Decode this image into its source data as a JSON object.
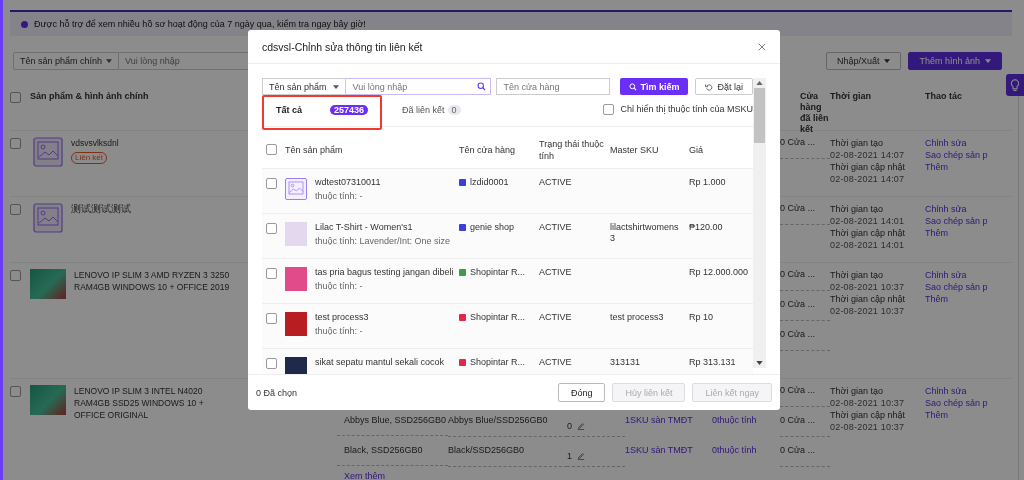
{
  "notice": {
    "text": "Được hỗ trợ để xem nhiều hồ sơ hoạt động của 7 ngày qua, kiểm tra ngay bây giờ!"
  },
  "filters": {
    "field": "Tên sản phẩm chính",
    "search": {
      "placeholder": "Vui lòng nhập"
    }
  },
  "toolbar_buttons": [
    {
      "label": "Nhập/Xuất",
      "kind": "secondary"
    },
    {
      "label": "Thêm hình ảnh",
      "kind": "primary"
    }
  ],
  "table": {
    "select_all": {
      "checked": false
    },
    "columns": [
      "Sản phẩm & hình ảnh chính",
      "Cửa hàng đã liên kết",
      "Thời gian",
      "Thao tác"
    ],
    "rows": [
      {
        "checked": false,
        "kind": "placeholder",
        "name": "vdsvsvlksdnl",
        "tag": "Liên kết",
        "variants": [
          {
            "stores": "0 Cửa ..."
          }
        ],
        "created_label": "Thời gian tạo",
        "created": "02-08-2021 14:07",
        "updated_label": "Thời gian cập nhật",
        "updated": "02-08-2021 14:07",
        "actions": [
          "Chỉnh sửa",
          "Sao chép sản p",
          "Thêm"
        ]
      },
      {
        "checked": false,
        "kind": "placeholder",
        "name": "测试测试测试",
        "variants": [
          {
            "stores": "0 Cửa ..."
          }
        ],
        "created_label": "Thời gian tạo",
        "created": "02-08-2021 14:01",
        "updated_label": "Thời gian cập nhật",
        "updated": "02-08-2021 14:01",
        "actions": [
          "Chỉnh sửa",
          "Sao chép sản p",
          "Thêm"
        ]
      },
      {
        "checked": false,
        "kind": "photo",
        "name": "LENOVO IP SLIM 3 AMD RYZEN 3 3250 RAM4GB WINDOWS 10 + OFFICE 2019",
        "variants": [
          {
            "stores": "0 Cửa ..."
          },
          {
            "stores": "0 Cửa ..."
          },
          {
            "stores": "0 Cửa ..."
          }
        ],
        "created_label": "Thời gian tạo",
        "created": "02-08-2021 10:37",
        "updated_label": "Thời gian cập nhật",
        "updated": "02-08-2021 10:37",
        "actions": [
          "Chỉnh sửa",
          "Sao chép sản p",
          "Thêm"
        ]
      },
      {
        "checked": false,
        "kind": "photo",
        "name": "LENOVO IP SLIM 3 INTEL N4020 RAM4GB SSD25 WINDOWS 10 + OFFICE ORIGINAL",
        "variants": [
          {
            "stores": "0 Cửa ..."
          },
          {
            "variant": "Abbys Blue, SSD256GB0",
            "sku": "Abbys Blue/SSD256GB0",
            "stock": "0",
            "sku_link": "1SKU sàn TMĐT",
            "attr_link": "0thuộc tính",
            "stores": "0 Cửa ..."
          },
          {
            "variant": "Black, SSD256GB0",
            "sku": "Black/SSD256GB0",
            "stock": "1",
            "sku_link": "1SKU sàn TMĐT",
            "attr_link": "0thuộc tính",
            "stores": "0 Cửa ..."
          }
        ],
        "more": "Xem thêm",
        "created_label": "Thời gian tạo",
        "created": "02-08-2021 10:37",
        "updated_label": "Thời gian cập nhật",
        "updated": "02-08-2021 10:37",
        "actions": [
          "Chỉnh sửa",
          "Sao chép sản p",
          "Thêm"
        ]
      }
    ]
  },
  "dialog": {
    "title": "cdsvsl-Chỉnh sửa thông tin liên kết",
    "field": "Tên sản phẩm",
    "search": {
      "placeholder": "Vui lòng nhập"
    },
    "store_search": {
      "placeholder": "Tên cửa hàng"
    },
    "search_button": "Tìm kiếm",
    "reset_button": "Đặt lại",
    "tabs": [
      {
        "label": "Tất cả",
        "count": "257436",
        "selected": true,
        "highlighted": true
      },
      {
        "label": "Đã liên kết",
        "count": "0",
        "selected": false,
        "highlighted": false
      }
    ],
    "msku_only": {
      "label": "Chỉ hiển thị thuộc tính của MSKU",
      "checked": false
    },
    "select_all": {
      "checked": false
    },
    "columns": [
      "Tên sản phẩm",
      "Tên cửa hàng",
      "Trạng thái thuộc tính",
      "Master SKU",
      "Giá"
    ],
    "rows": [
      {
        "checked": false,
        "kind": "placeholder",
        "name": "wdtest07310011",
        "attribute": "thuộc tính: -",
        "store": "lzdid0001",
        "color": "#3b3fd8",
        "status": "ACTIVE",
        "price": "Rp 1.000"
      },
      {
        "checked": false,
        "kind": "photo",
        "name": "Lilac T-Shirt - Women's1",
        "attribute": "thuộc tính: Lavender/Int: One size",
        "store": "genie shop",
        "color": "#3b3fd8",
        "status": "ACTIVE",
        "sku": "lilactshirtwomens 3",
        "price": "₱120.00"
      },
      {
        "checked": false,
        "kind": "photo",
        "name": "tas pria bagus testing jangan dibeli",
        "attribute": "thuộc tính: -",
        "store": "Shopintar R...",
        "color": "#3f9a4a",
        "status": "ACTIVE",
        "price": "Rp 12.000.000"
      },
      {
        "checked": false,
        "kind": "photo",
        "name": "test process3",
        "attribute": "thuộc tính: -",
        "store": "Shopintar R...",
        "color": "#e0284a",
        "status": "ACTIVE",
        "sku": "test process3",
        "price": "Rp 10"
      },
      {
        "checked": false,
        "kind": "photo",
        "name": "sikat sepatu mantul sekali cocok",
        "store": "Shopintar R...",
        "color": "#e0284a",
        "status": "ACTIVE",
        "sku": "313131",
        "price": "Rp 313.131"
      }
    ],
    "selected_count": "0 Đã chọn",
    "buttons": [
      {
        "label": "Đóng",
        "disabled": false
      },
      {
        "label": "Hủy liên kết",
        "disabled": true
      },
      {
        "label": "Liên kết ngay",
        "disabled": true
      }
    ]
  }
}
